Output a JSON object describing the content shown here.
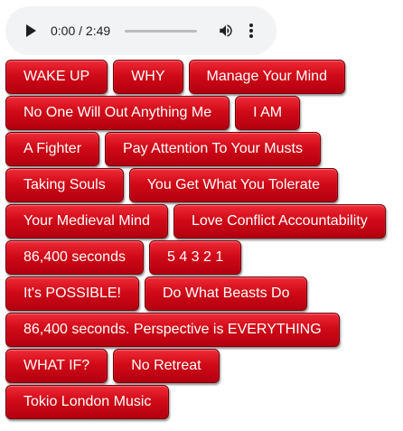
{
  "audio": {
    "time_display": "0:00 / 2:49",
    "progress": 0,
    "icons": {
      "play": "play-icon",
      "volume": "volume-icon",
      "more": "more-vertical-icon"
    }
  },
  "colors": {
    "button_red": "#d10a18",
    "button_border": "#7a0008",
    "player_bg": "#f1f3f4"
  },
  "rows": [
    [
      "WAKE UP",
      "WHY",
      "Manage Your Mind"
    ],
    [
      "No One Will Out Anything Me",
      "I AM"
    ],
    [
      "A Fighter",
      "Pay Attention To Your Musts"
    ],
    [
      "Taking Souls",
      "You Get What You Tolerate"
    ],
    [
      "Your Medieval Mind",
      "Love Conflict Accountability"
    ],
    [
      "86,400 seconds",
      "5 4 3 2 1"
    ],
    [
      "It's POSSIBLE!",
      "Do What Beasts Do"
    ],
    [
      "86,400 seconds. Perspective is EVERYTHING"
    ],
    [
      "WHAT IF?",
      "No Retreat"
    ],
    [
      "Tokio London Music"
    ]
  ]
}
